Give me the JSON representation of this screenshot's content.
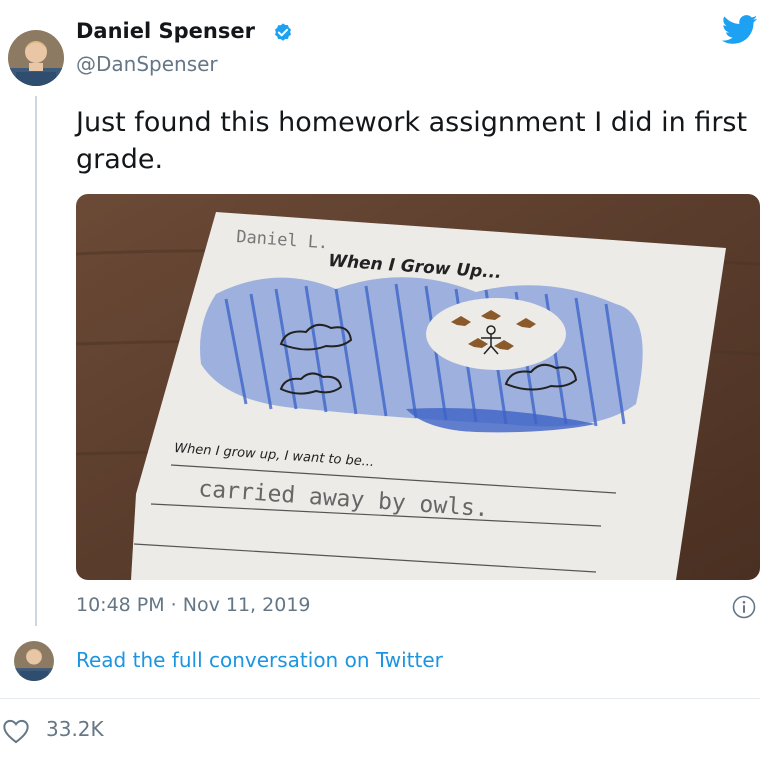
{
  "author": {
    "name": "Daniel Spenser",
    "handle": "@DanSpenser"
  },
  "tweet": {
    "text": "Just found this homework assignment I did in first grade.",
    "timestamp": "10:48 PM · Nov 11, 2019"
  },
  "media": {
    "student_name": "Daniel L.",
    "title": "When I Grow Up...",
    "prompt": "When I grow up, I want to be...",
    "answer": "carried away by owls."
  },
  "footer": {
    "read_link": "Read the full conversation on Twitter",
    "likes": "33.2K"
  },
  "icons": {
    "verified": "verified-badge-icon",
    "bird": "twitter-bird-icon",
    "info": "info-icon",
    "heart": "heart-icon"
  },
  "colors": {
    "twitter_blue": "#1da1f2",
    "link_blue": "#1b95e0",
    "secondary_text": "#657786"
  }
}
